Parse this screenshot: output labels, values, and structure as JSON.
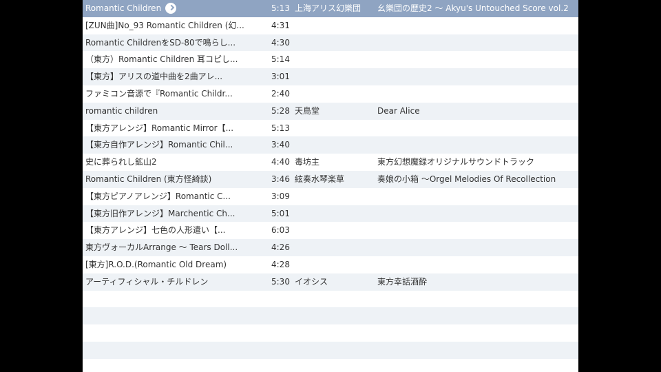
{
  "tracks": [
    {
      "title": "Romantic Children",
      "time": "5:13",
      "artist": "上海アリス幻樂団",
      "album": "幺樂団の歴史2 ～ Akyu's Untouched Score vol.2"
    },
    {
      "title": "[ZUN曲]No_93 Romantic Children (幻...",
      "time": "4:31",
      "artist": "",
      "album": ""
    },
    {
      "title": "Romantic ChildrenをSD-80で鳴らし...",
      "time": "4:30",
      "artist": "",
      "album": ""
    },
    {
      "title": "（東方）Romantic Children 耳コピし...",
      "time": "5:14",
      "artist": "",
      "album": ""
    },
    {
      "title": "【東方】アリスの道中曲を2曲アレ...",
      "time": "3:01",
      "artist": "",
      "album": ""
    },
    {
      "title": "ファミコン音源で『Romantic Childr...",
      "time": "2:40",
      "artist": "",
      "album": ""
    },
    {
      "title": "romantic children",
      "time": "5:28",
      "artist": "天鳥堂",
      "album": "Dear Alice"
    },
    {
      "title": "【東方アレンジ】Romantic Mirror【...",
      "time": "5:13",
      "artist": "",
      "album": ""
    },
    {
      "title": "【東方自作アレンジ】Romantic Chil...",
      "time": "3:40",
      "artist": "",
      "album": ""
    },
    {
      "title": "史に葬られし鉱山2",
      "time": "4:40",
      "artist": "毒坊主",
      "album": "東方幻想魔録オリジナルサウンドトラック"
    },
    {
      "title": "Romantic Children (東方怪綺談)",
      "time": "3:46",
      "artist": "絃奏水琴楽草",
      "album": "奏娘の小箱 ～Orgel Melodies Of Recollection"
    },
    {
      "title": "【東方ピアノアレンジ】Romantic C...",
      "time": "3:09",
      "artist": "",
      "album": ""
    },
    {
      "title": "【東方旧作アレンジ】Marchentic Ch...",
      "time": "5:01",
      "artist": "",
      "album": ""
    },
    {
      "title": "【東方アレンジ】七色の人形遣い【...",
      "time": "6:03",
      "artist": "",
      "album": ""
    },
    {
      "title": "東方ヴォーカルArrange ～ Tears Doll...",
      "time": "4:26",
      "artist": "",
      "album": ""
    },
    {
      "title": "[東方]R.O.D.(Romantic Old Dream)",
      "time": "4:28",
      "artist": "",
      "album": ""
    },
    {
      "title": "アーティフィシャル・チルドレン",
      "time": "5:30",
      "artist": "イオシス",
      "album": "東方幸話酒酔"
    }
  ]
}
